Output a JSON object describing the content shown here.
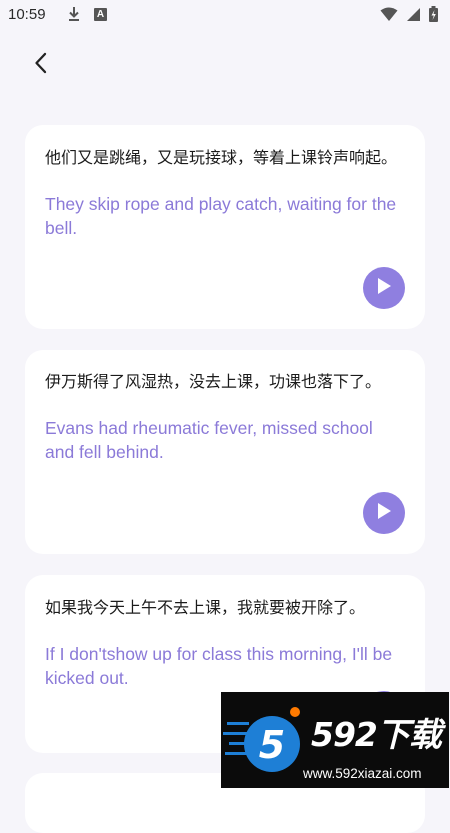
{
  "status_bar": {
    "time": "10:59",
    "notification_letter": "A"
  },
  "nav": {
    "back_icon": "chevron-left-icon"
  },
  "cards": [
    {
      "chinese": "他们又是跳绳，又是玩接球，等着上课铃声响起。",
      "english": "They skip rope and play catch, waiting for the bell.",
      "play_icon": "play-icon"
    },
    {
      "chinese": "伊万斯得了风湿热，没去上课，功课也落下了。",
      "english": "Evans had rheumatic fever, missed school and fell behind.",
      "play_icon": "play-icon"
    },
    {
      "chinese": "如果我今天上午不去上课，我就要被开除了。",
      "english": "If I don'tshow up for class this morning, I'll be kicked out.",
      "play_icon": "play-icon"
    }
  ],
  "watermark": {
    "logo_text": "592下载",
    "url": "www.592xiazai.com"
  },
  "colors": {
    "background": "#f6f5fa",
    "card": "#ffffff",
    "accent": "#8f7fe0",
    "english_text": "#8b7ad8"
  }
}
